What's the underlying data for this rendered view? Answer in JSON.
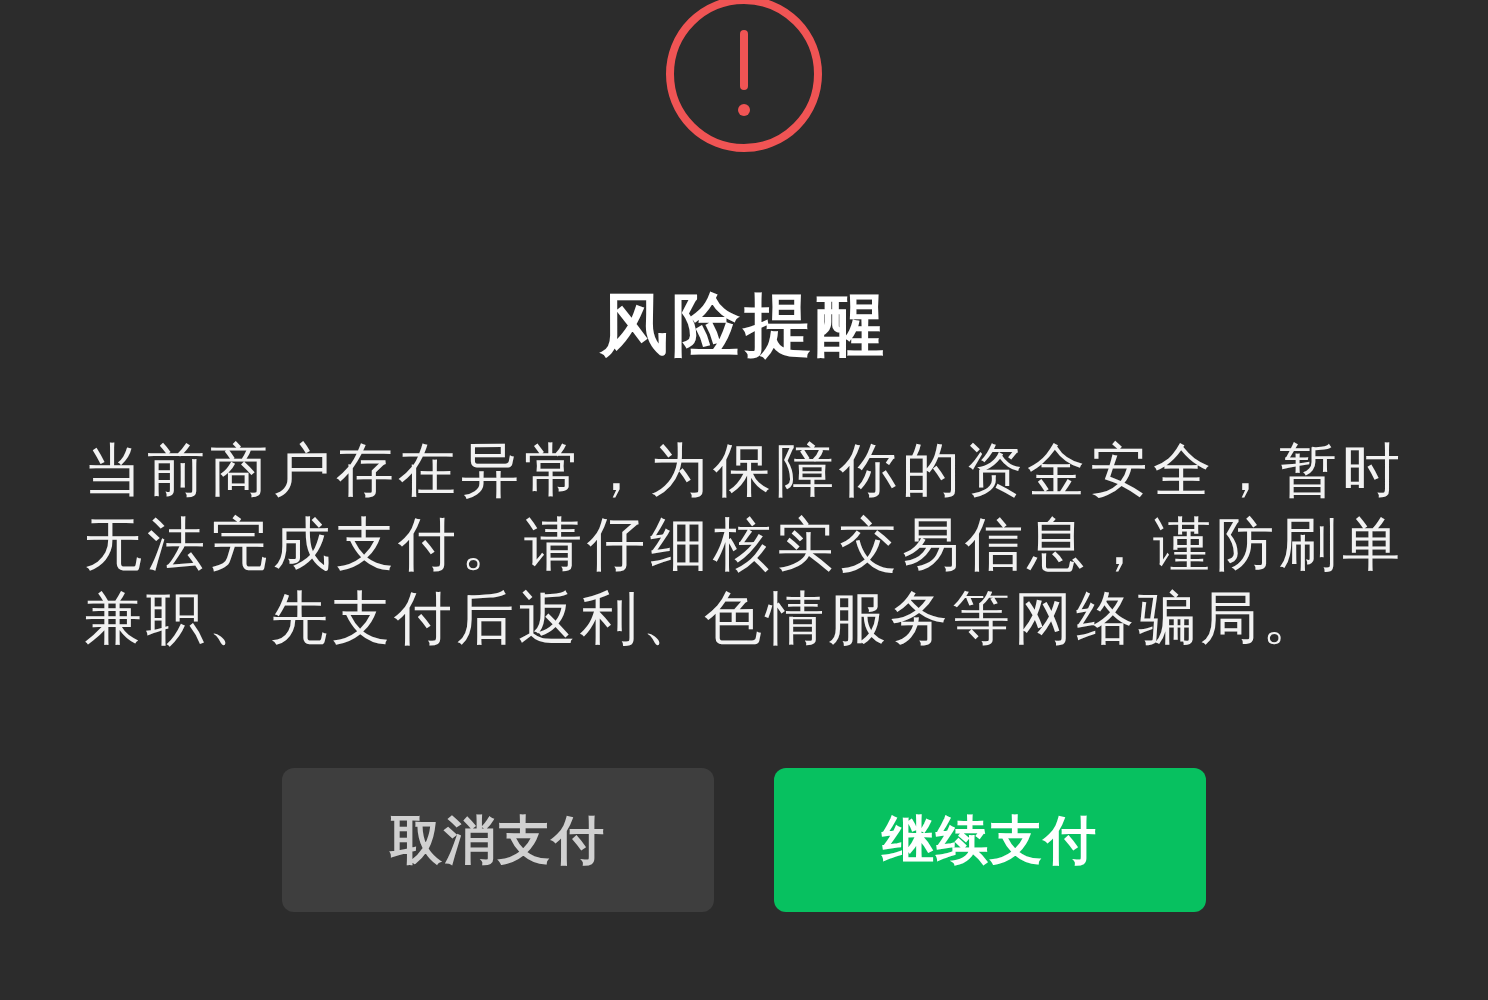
{
  "dialog": {
    "title": "风险提醒",
    "message": "当前商户存在异常，为保障你的资金安全，暂时无法完成支付。请仔细核实交易信息，谨防刷单兼职、先支付后返利、色情服务等网络骗局。",
    "buttons": [
      {
        "label": "取消支付",
        "kind": "secondary"
      },
      {
        "label": "继续支付",
        "kind": "primary"
      }
    ]
  }
}
